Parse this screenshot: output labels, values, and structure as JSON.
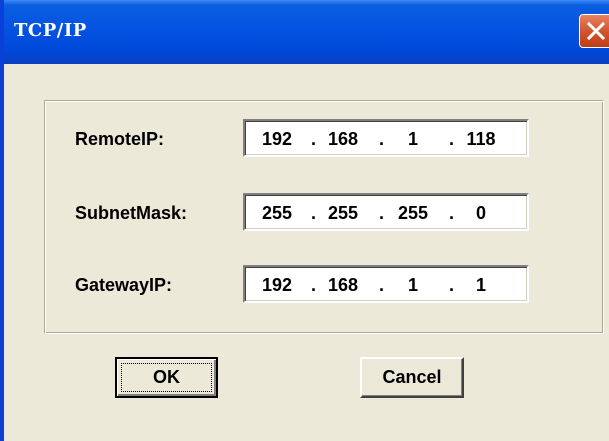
{
  "window": {
    "title": "TCP/IP",
    "close_icon": "close-icon"
  },
  "fields": [
    {
      "label": "RemoteIP:",
      "octets": [
        "192",
        "168",
        "1",
        "118"
      ]
    },
    {
      "label": "SubnetMask:",
      "octets": [
        "255",
        "255",
        "255",
        "0"
      ]
    },
    {
      "label": "GatewayIP:",
      "octets": [
        "192",
        "168",
        "1",
        "1"
      ]
    }
  ],
  "separator": ".",
  "buttons": {
    "ok_label": "OK",
    "cancel_label": "Cancel"
  },
  "colors": {
    "titlebar": "#0553e2",
    "close_button": "#d2552f",
    "dialog_face": "#ece9d8"
  }
}
